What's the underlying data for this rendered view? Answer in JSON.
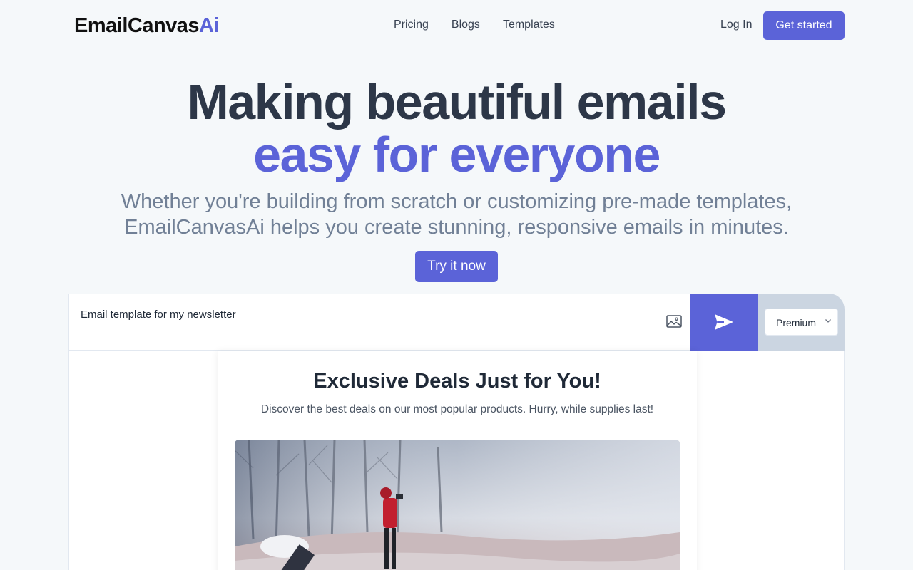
{
  "header": {
    "logo_main": "EmailCanvas",
    "logo_accent": "Ai",
    "nav": [
      "Pricing",
      "Blogs",
      "Templates"
    ],
    "login_label": "Log In",
    "cta_label": "Get started"
  },
  "hero": {
    "line1": "Making beautiful emails",
    "line2": "easy for everyone",
    "subtitle_line1": "Whether you're building from scratch or customizing pre-made templates,",
    "subtitle_line2": "EmailCanvasAi helps you create stunning, responsive emails in minutes.",
    "try_label": "Try it now"
  },
  "prompt": {
    "value": "Email template for my newsletter",
    "image_icon": "image-icon",
    "send_icon": "send-icon",
    "plan_selected": "Premium"
  },
  "preview": {
    "title": "Exclusive Deals Just for You!",
    "subtitle": "Discover the best deals on our most popular products. Hurry, while supplies last!"
  },
  "colors": {
    "accent": "#5b63d8",
    "heading": "#2d3748",
    "muted": "#718096",
    "background": "#f5f8fa"
  }
}
